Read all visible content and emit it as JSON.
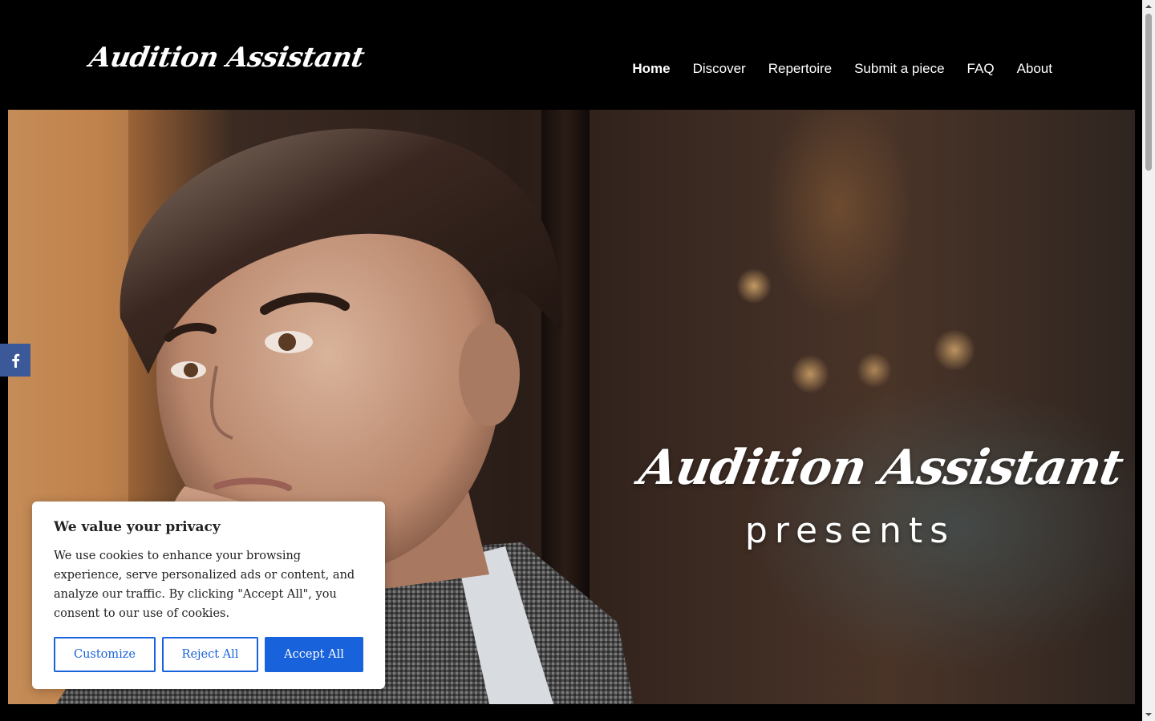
{
  "header": {
    "logo": "Audition Assistant",
    "nav": [
      {
        "label": "Home",
        "active": true
      },
      {
        "label": "Discover",
        "active": false
      },
      {
        "label": "Repertoire",
        "active": false
      },
      {
        "label": "Submit a piece",
        "active": false
      },
      {
        "label": "FAQ",
        "active": false
      },
      {
        "label": "About",
        "active": false
      }
    ]
  },
  "hero": {
    "title": "Audition Assistant",
    "subtitle": "presents"
  },
  "social": {
    "facebook_icon": "facebook-icon",
    "facebook_color": "#3b5998"
  },
  "cookie_banner": {
    "title": "We value your privacy",
    "text": "We use cookies to enhance your browsing experience, serve personalized ads or content, and analyze our traffic. By clicking \"Accept All\", you consent to our use of cookies.",
    "customize_label": "Customize",
    "reject_label": "Reject All",
    "accept_label": "Accept All",
    "accent_color": "#1863dc"
  }
}
